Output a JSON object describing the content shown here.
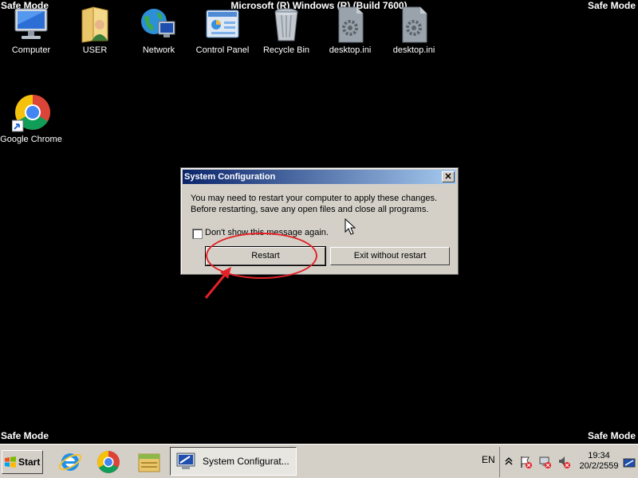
{
  "desktop": {
    "safe_mode_label": "Safe Mode",
    "build_label": "Microsoft (R) Windows (R) (Build 7600)",
    "icons": [
      {
        "label": "Computer",
        "icon": "computer-icon"
      },
      {
        "label": "USER",
        "icon": "user-folder-icon"
      },
      {
        "label": "Network",
        "icon": "network-icon"
      },
      {
        "label": "Control Panel",
        "icon": "control-panel-icon"
      },
      {
        "label": "Recycle Bin",
        "icon": "recycle-bin-icon"
      },
      {
        "label": "desktop.ini",
        "icon": "settings-file-icon"
      },
      {
        "label": "desktop.ini",
        "icon": "settings-file-icon"
      },
      {
        "label": "Google Chrome",
        "icon": "chrome-icon"
      }
    ]
  },
  "dialog": {
    "title": "System Configuration",
    "close_label": "✕",
    "message_line1": "You may need to restart your computer to apply these changes.",
    "message_line2": "Before restarting, save any open files and close all programs.",
    "checkbox_label": "Don't show this message again.",
    "checkbox_checked": false,
    "restart_label": "Restart",
    "exit_label": "Exit without restart"
  },
  "taskbar": {
    "start_label": "Start",
    "pinned": [
      "internet-explorer-icon",
      "chrome-icon",
      "explorer-folder-icon"
    ],
    "active_task_label": "System Configurat...",
    "language": "EN",
    "time": "19:34",
    "date": "20/2/2559"
  },
  "colors": {
    "desktop_bg": "#000000",
    "annotation": "#e32127",
    "title_start": "#0a246a",
    "title_end": "#a6caf0"
  }
}
